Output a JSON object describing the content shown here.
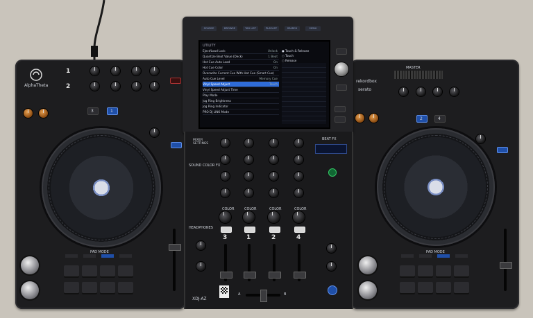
{
  "brand": {
    "logo_text": "AlphaTheta",
    "rekordbox": "rekordbox",
    "serato": "serato",
    "model": "XDJ-AZ"
  },
  "top_buttons": [
    "SOURCE",
    "BROWSE",
    "TAG LIST",
    "PLAYLIST",
    "SEARCH",
    "MENU"
  ],
  "screen": {
    "title": "UTILITY",
    "rows": [
      {
        "label": "Eject/Load Lock",
        "value": "Unlock"
      },
      {
        "label": "Quantize Beat Value (Deck)",
        "value": "1 Beat"
      },
      {
        "label": "Hot Cue Auto Load",
        "value": "On"
      },
      {
        "label": "Hot Cue Color",
        "value": "On"
      },
      {
        "label": "Overwrite Current Cue With Hot Cue (Smart Cue)",
        "value": ""
      },
      {
        "label": "Auto Cue Level",
        "value": "Memory Cue"
      },
      {
        "label": "Vinyl Speed Adjust",
        "value": "Touch"
      },
      {
        "label": "Vinyl Speed Adjust Time",
        "value": ""
      },
      {
        "label": "Play Mode",
        "value": ""
      },
      {
        "label": "Jog Ring Brightness",
        "value": ""
      },
      {
        "label": "Jog Ring Indicator",
        "value": ""
      },
      {
        "label": "PRO DJ LINK Mode",
        "value": ""
      }
    ],
    "selected_index": 6,
    "options": [
      "Touch & Release",
      "Touch",
      "Release"
    ]
  },
  "mixer": {
    "headphones": "HEADPHONES",
    "sound_color_fx": "SOUND COLOR FX",
    "color": "COLOR",
    "beat_fx": "BEAT FX",
    "mixer_settings": "MIXER SETTINGS",
    "channels": [
      "3",
      "1",
      "2",
      "4"
    ],
    "cue": "CUE",
    "cross_a": "A",
    "cross_b": "B"
  },
  "left_deck": {
    "deck_select": [
      "3",
      "1"
    ],
    "numbers": [
      "1",
      "2"
    ],
    "pad_mode": "PAD MODE"
  },
  "right_deck": {
    "deck_select": [
      "2",
      "4"
    ],
    "master": "MASTER",
    "pad_mode": "PAD MODE"
  }
}
